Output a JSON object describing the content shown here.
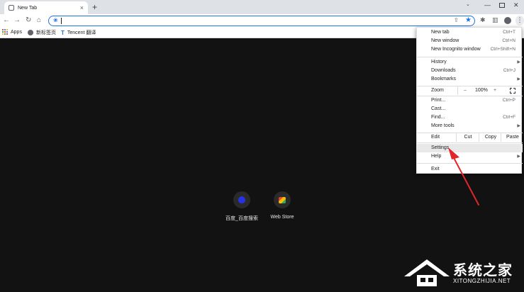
{
  "tab": {
    "title": "New Tab"
  },
  "bookmarks": [
    {
      "label": "Apps"
    },
    {
      "label": "新标签页"
    },
    {
      "label": "Tencent 翻译"
    }
  ],
  "shortcuts": [
    {
      "label": "百度_百度搜索"
    },
    {
      "label": "Web Store"
    }
  ],
  "menu": {
    "group1": [
      {
        "label": "New tab",
        "shortcut": "Ctrl+T"
      },
      {
        "label": "New window",
        "shortcut": "Ctrl+N"
      },
      {
        "label": "New Incognito window",
        "shortcut": "Ctrl+Shift+N"
      }
    ],
    "group2": [
      {
        "label": "History",
        "shortcut": ""
      },
      {
        "label": "Downloads",
        "shortcut": "Ctrl+J"
      },
      {
        "label": "Bookmarks",
        "shortcut": ""
      }
    ],
    "zoom": {
      "label": "Zoom",
      "minus": "–",
      "value": "100%",
      "plus": "+"
    },
    "group3": [
      {
        "label": "Print...",
        "shortcut": "Ctrl+P"
      },
      {
        "label": "Cast...",
        "shortcut": ""
      },
      {
        "label": "Find...",
        "shortcut": "Ctrl+F"
      },
      {
        "label": "More tools",
        "shortcut": ""
      }
    ],
    "edit": {
      "label": "Edit",
      "cut": "Cut",
      "copy": "Copy",
      "paste": "Paste"
    },
    "group4": [
      {
        "label": "Settings"
      },
      {
        "label": "Help"
      }
    ],
    "exit": {
      "label": "Exit"
    }
  },
  "watermark": {
    "cn": "系统之家",
    "en": "XITONGZHIJIA.NET"
  },
  "colors": {
    "accent": "#1a73e8",
    "arrow": "#e0262b",
    "ntp_bg": "#121212"
  }
}
